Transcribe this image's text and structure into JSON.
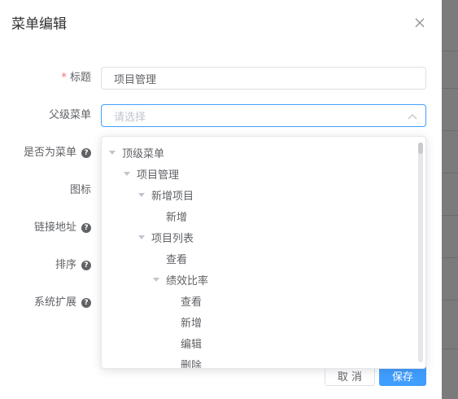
{
  "dialog": {
    "title": "菜单编辑",
    "close_icon": "close-icon"
  },
  "form": {
    "title_label": "标题",
    "required_mark": "*",
    "title_value": "项目管理",
    "parent_label": "父级菜单",
    "parent_placeholder": "请选择",
    "is_menu_label": "是否为菜单",
    "icon_label": "图标",
    "link_label": "链接地址",
    "sort_label": "排序",
    "ext_label": "系统扩展",
    "help_glyph": "?"
  },
  "tree": [
    {
      "label": "顶级菜单",
      "expanded": true
    },
    {
      "label": "项目管理",
      "expanded": true
    },
    {
      "label": "新增项目",
      "expanded": true
    },
    {
      "label": "新增",
      "expanded": false
    },
    {
      "label": "项目列表",
      "expanded": true
    },
    {
      "label": "查看",
      "expanded": false
    },
    {
      "label": "绩效比率",
      "expanded": true
    },
    {
      "label": "查看",
      "expanded": false
    },
    {
      "label": "新增",
      "expanded": false
    },
    {
      "label": "编辑",
      "expanded": false
    },
    {
      "label": "删除",
      "expanded": false
    }
  ],
  "footer": {
    "cancel_label": "取 消",
    "save_label": "保存"
  },
  "colors": {
    "primary": "#409eff",
    "required": "#f56c6c",
    "backdrop": "#7b7b7b"
  }
}
